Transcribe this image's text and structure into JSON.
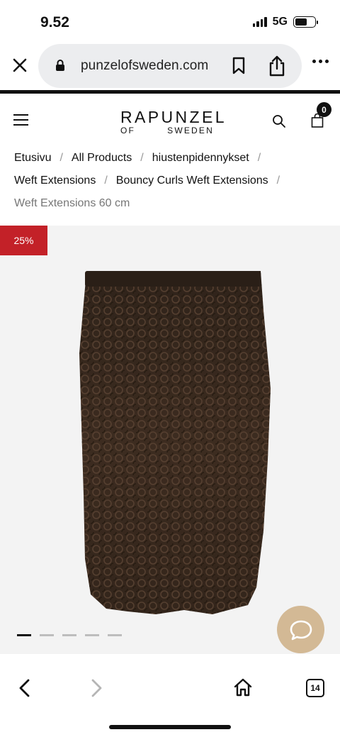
{
  "status": {
    "time": "9.52",
    "network": "5G"
  },
  "browser": {
    "url": "punzelofsweden.com",
    "icons": [
      "close-icon",
      "lock-icon",
      "bookmark-icon",
      "share-icon",
      "more-icon"
    ]
  },
  "header": {
    "logo_top": "RAPUNZEL",
    "logo_of": "OF",
    "logo_sweden": "SWEDEN",
    "cart_count": "0",
    "icons": [
      "menu-icon",
      "search-icon",
      "bag-icon"
    ]
  },
  "breadcrumb": {
    "items": [
      "Etusivu",
      "All Products",
      "hiustenpidennykset",
      "Weft Extensions",
      "Bouncy Curls Weft Extensions",
      "Weft Extensions 60 cm"
    ],
    "separator": "/"
  },
  "product": {
    "discount": "25%",
    "image_count": 5,
    "active_image": 1,
    "hair_color": "#3a2a1f",
    "chat_color": "#d3b995"
  },
  "toolbar": {
    "tabs_count": "14",
    "icons": [
      "back-icon",
      "forward-icon",
      "home-icon",
      "tabs-icon"
    ]
  },
  "colors": {
    "discount_badge": "#c32128",
    "gallery_bg": "#f3f3f3",
    "url_pill": "#ecedef"
  }
}
